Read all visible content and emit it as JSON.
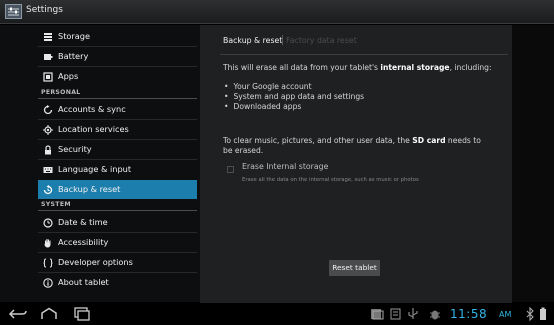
{
  "titlebar": {
    "title": "Settings"
  },
  "sidebar": {
    "items_top": [
      {
        "label": "Storage",
        "icon": "storage-icon"
      },
      {
        "label": "Battery",
        "icon": "battery-icon"
      },
      {
        "label": "Apps",
        "icon": "apps-icon"
      }
    ],
    "section_personal": "PERSONAL",
    "items_personal": [
      {
        "label": "Accounts & sync",
        "icon": "sync-icon"
      },
      {
        "label": "Location services",
        "icon": "location-icon"
      },
      {
        "label": "Security",
        "icon": "lock-icon"
      },
      {
        "label": "Language & input",
        "icon": "keyboard-icon"
      },
      {
        "label": "Backup & reset",
        "icon": "backup-reset-icon",
        "selected": true
      }
    ],
    "section_system": "SYSTEM",
    "items_system": [
      {
        "label": "Date & time",
        "icon": "clock-icon"
      },
      {
        "label": "Accessibility",
        "icon": "hand-icon"
      },
      {
        "label": "Developer options",
        "icon": "braces-icon"
      },
      {
        "label": "About tablet",
        "icon": "info-icon"
      }
    ]
  },
  "panel": {
    "breadcrumb_active": "Backup & reset",
    "breadcrumb_inactive": "Factory data reset",
    "warning_prefix": "This will erase all data from your tablet's ",
    "warning_bold": "internal storage",
    "warning_suffix": ", including:",
    "bullets": [
      "Your Google account",
      "System and app data and settings",
      "Downloaded apps"
    ],
    "sd_prefix": "To clear music, pictures, and other user data, the ",
    "sd_bold": "SD card",
    "sd_suffix": " needs to",
    "sd_line2": "be erased.",
    "erase_title": "Erase Internal storage",
    "erase_desc": "Erase all the data on the internal storage, such as music or photos",
    "reset_button": "Reset tablet"
  },
  "statusbar": {
    "time": "11:58",
    "ampm": "AM"
  },
  "colors": {
    "accent": "#33b5e5",
    "selected": "#1c7ead"
  }
}
